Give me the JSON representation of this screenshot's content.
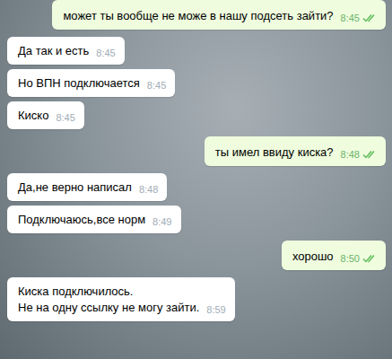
{
  "chat": {
    "messages": [
      {
        "text": "может ты вообще не може в нашу подсеть зайти?",
        "time": "8:45",
        "outgoing": true,
        "read": true
      },
      {
        "text": "Да так и есть",
        "time": "8:45",
        "outgoing": false,
        "read": false
      },
      {
        "text": "Но ВПН подключается",
        "time": "8:45",
        "outgoing": false,
        "read": false
      },
      {
        "text": "Киско",
        "time": "8:45",
        "outgoing": false,
        "read": false
      },
      {
        "text": "ты имел ввиду киска?",
        "time": "8:48",
        "outgoing": true,
        "read": true
      },
      {
        "text": "Да,не верно написал",
        "time": "8:48",
        "outgoing": false,
        "read": false
      },
      {
        "text": "Подключаюсь,все норм",
        "time": "8:49",
        "outgoing": false,
        "read": false
      },
      {
        "text": "хорошо",
        "time": "8:50",
        "outgoing": true,
        "read": true
      },
      {
        "text": "Киска подключилось.\nНе на одну ссылку не могу зайти.",
        "time": "8:59",
        "outgoing": false,
        "read": false
      }
    ]
  }
}
